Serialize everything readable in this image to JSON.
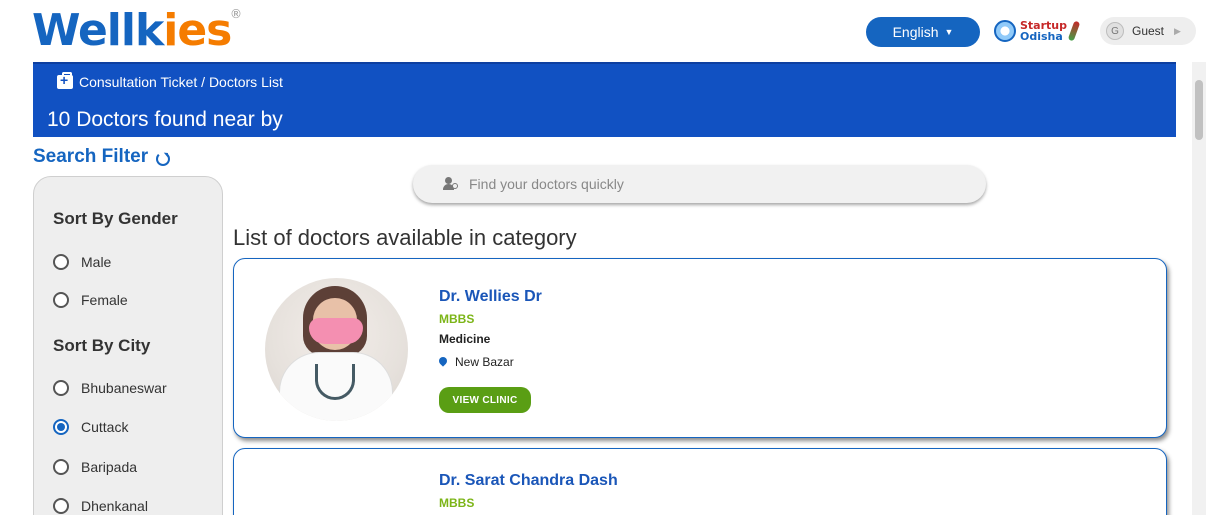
{
  "header": {
    "logo_main": "Wellk",
    "logo_accent": "ies",
    "logo_reg": "®",
    "language": "English",
    "partner_line1": "Startup",
    "partner_line2": "Odisha",
    "user_initial": "G",
    "user_name": "Guest"
  },
  "banner": {
    "breadcrumb": "Consultation Ticket / Doctors List",
    "count_title": "10 Doctors found near by"
  },
  "sidebar": {
    "title": "Search Filter",
    "gender_heading": "Sort By Gender",
    "gender_options": [
      "Male",
      "Female"
    ],
    "city_heading": "Sort By City",
    "city_options": [
      "Bhubaneswar",
      "Cuttack",
      "Baripada",
      "Dhenkanal"
    ],
    "selected_city": "Cuttack"
  },
  "search": {
    "placeholder": "Find your doctors quickly"
  },
  "main": {
    "list_title": "List of doctors available in category",
    "view_clinic_label": "VIEW CLINIC",
    "doctors": [
      {
        "name": "Dr. Wellies Dr",
        "degree": "MBBS",
        "speciality": "Medicine",
        "location": "New Bazar"
      },
      {
        "name": "Dr. Sarat Chandra Dash",
        "degree": "MBBS"
      }
    ]
  },
  "colors": {
    "brand_blue": "#1565c0",
    "banner_blue": "#1151c2",
    "brand_orange": "#f57c00",
    "degree_green": "#7cb518",
    "button_green": "#5a9e14"
  }
}
